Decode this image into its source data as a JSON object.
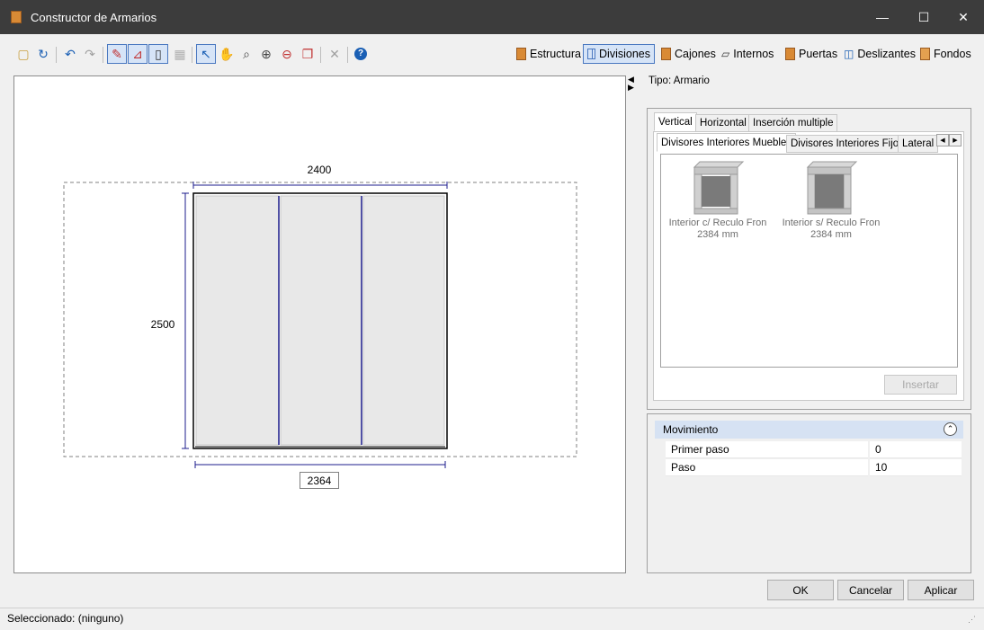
{
  "window": {
    "title": "Constructor de Armarios",
    "minimize": "—",
    "maximize": "☐",
    "close": "✕"
  },
  "modes": [
    {
      "label": "Estructura"
    },
    {
      "label": "Divisiones"
    },
    {
      "label": "Cajones"
    },
    {
      "label": "Internos"
    },
    {
      "label": "Puertas"
    },
    {
      "label": "Deslizantes"
    },
    {
      "label": "Fondos"
    }
  ],
  "drawing": {
    "width_top": "2400",
    "height_left": "2500",
    "width_bottom": "2364",
    "columns": 3
  },
  "type_label": "Tipo: Armario",
  "tabs_top": {
    "vertical": "Vertical",
    "horizontal": "Horizontal",
    "multiple": "Inserción multiple"
  },
  "tabs_sub": {
    "muebles": "Divisores Interiores Muebles",
    "fijos": "Divisores Interiores Fijos",
    "lateral": "Lateral"
  },
  "library": [
    {
      "line1": "Interior c/ Reculo Fron",
      "line2": "2384 mm"
    },
    {
      "line1": "Interior s/ Reculo Fron",
      "line2": "2384 mm"
    }
  ],
  "insert_button": "Insertar",
  "properties": {
    "section": "Movimiento",
    "rows": [
      {
        "name": "Primer paso",
        "value": "0"
      },
      {
        "name": "Paso",
        "value": "10"
      }
    ]
  },
  "buttons": {
    "ok": "OK",
    "cancel": "Cancelar",
    "apply": "Aplicar"
  },
  "status": "Seleccionado: (ninguno)",
  "colors": {
    "titlebar": "#3c3c3c",
    "accent": "#1c1c8c",
    "section_header": "#d6e2f3",
    "panel_fill": "#e8e8e8"
  }
}
